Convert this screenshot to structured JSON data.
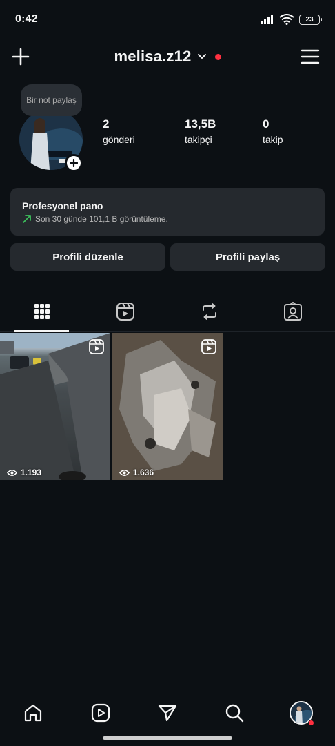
{
  "status_bar": {
    "time": "0:42",
    "battery": "23"
  },
  "header": {
    "username": "melisa.z12",
    "icons": [
      "plus-icon",
      "chevron-down-icon",
      "hamburger-menu-icon"
    ],
    "notification_dot_color": "#ff3040"
  },
  "profile": {
    "note_bubble": "Bir not paylaş",
    "stats": [
      {
        "value": "2",
        "label": "gönderi"
      },
      {
        "value": "13,5B",
        "label": "takipçi"
      },
      {
        "value": "0",
        "label": "takip"
      }
    ]
  },
  "pro_panel": {
    "title": "Profesyonel pano",
    "subtitle": "Son 30 günde 101,1 B görüntüleme.",
    "trend_color": "#3cc15c"
  },
  "actions": {
    "edit_profile": "Profili düzenle",
    "share_profile": "Profili paylaş"
  },
  "tabs": [
    "grid-icon",
    "reels-icon",
    "reposts-icon",
    "tagged-icon"
  ],
  "grid": [
    {
      "views": "1.193",
      "type": "reel"
    },
    {
      "views": "1.636",
      "type": "reel"
    }
  ],
  "bottom_nav": [
    "home-icon",
    "reels-icon",
    "direct-message-icon",
    "search-icon",
    "profile-avatar"
  ]
}
